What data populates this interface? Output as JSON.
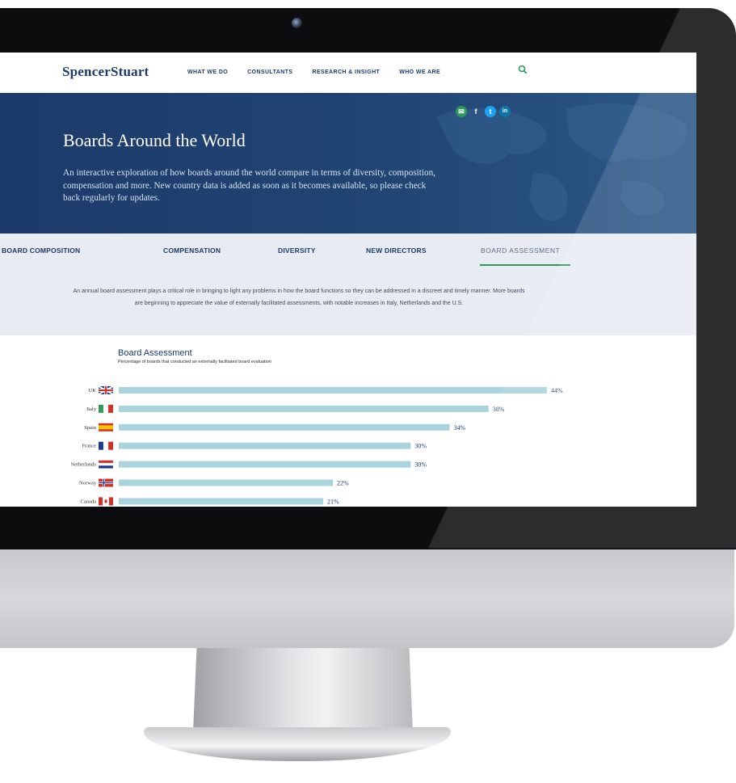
{
  "site": {
    "logo": "SpencerStuart",
    "nav": [
      "WHAT WE DO",
      "CONSULTANTS",
      "RESEARCH & INSIGHT",
      "WHO WE ARE"
    ]
  },
  "hero": {
    "title": "Boards Around the World",
    "description": "An interactive exploration of how boards around the world compare in terms of diversity, composition, compensation and more. New country data is added as soon as it becomes available, so please check back regularly for updates."
  },
  "tabs": [
    "BOARD COMPOSITION",
    "COMPENSATION",
    "DIVERSITY",
    "NEW DIRECTORS",
    "BOARD ASSESSMENT"
  ],
  "active_tab": "BOARD ASSESSMENT",
  "intro_text": "An annual board assessment plays a critical role in bringing to light any problems in how the board functions so they can be addressed in a discreet and timely manner. More boards are beginning to appreciate the value of externally facilitated assessments, with notable increases in Italy, Netherlands and the U.S.",
  "colors": {
    "brand_navy": "#1c3a6b",
    "accent_green": "#2e9a5a",
    "bar_color": "#a9d3dd",
    "tab_bg": "#e8ecf2"
  },
  "icons": [
    "search-icon",
    "share-icon",
    "facebook-icon",
    "twitter-icon",
    "linkedin-icon"
  ],
  "chart_data": {
    "type": "bar",
    "orientation": "horizontal",
    "title": "Board Assessment",
    "subtitle": "Percentage of boards that conducted an externally facilitated board evaluation",
    "categories": [
      "UK",
      "Italy",
      "Spain",
      "France",
      "Netherlands",
      "Norway",
      "Canada"
    ],
    "values": [
      44,
      38,
      34,
      30,
      30,
      22,
      21
    ],
    "value_labels": [
      "44%",
      "38%",
      "34%",
      "30%",
      "30%",
      "22%",
      "21%"
    ],
    "xlim": [
      0,
      44
    ],
    "grid": false,
    "legend": "none"
  }
}
